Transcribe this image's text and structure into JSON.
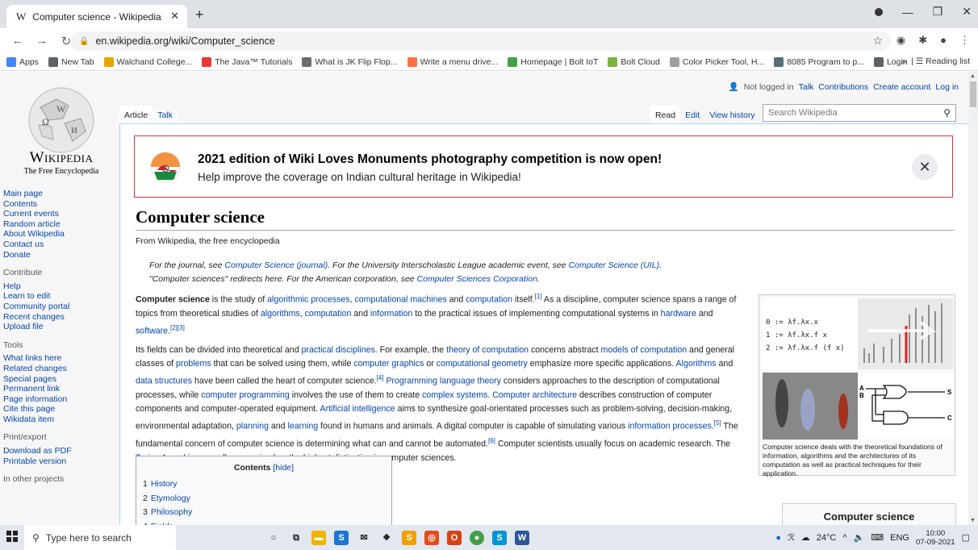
{
  "browser": {
    "tab_title": "Computer science - Wikipedia",
    "tab_favicon": "W",
    "url": "en.wikipedia.org/wiki/Computer_science",
    "bookmarks": [
      {
        "label": "Apps",
        "icon": "apps-grid-icon",
        "color": "#4285f4"
      },
      {
        "label": "New Tab",
        "icon": "globe-icon",
        "color": "#5f6368"
      },
      {
        "label": "Walchand College...",
        "icon": "college-icon",
        "color": "#e8a500"
      },
      {
        "label": "The Java™ Tutorials",
        "icon": "youtube-icon",
        "color": "#e53935"
      },
      {
        "label": "What is JK Flip Flop...",
        "icon": "site-icon",
        "color": "#6d6d6d"
      },
      {
        "label": "Write a menu drive...",
        "icon": "blogger-icon",
        "color": "#ff7043"
      },
      {
        "label": "Homepage | Bolt IoT",
        "icon": "bolt-icon",
        "color": "#43a047"
      },
      {
        "label": "Bolt Cloud",
        "icon": "bolt-cloud-icon",
        "color": "#7cb342"
      },
      {
        "label": "Color Picker Tool, H...",
        "icon": "color-picker-icon",
        "color": "#9e9e9e"
      },
      {
        "label": "8085 Program to p...",
        "icon": "site-icon",
        "color": "#546e7a"
      },
      {
        "label": "Login",
        "icon": "globe-icon",
        "color": "#5f6368"
      }
    ],
    "reading_list": "Reading list",
    "overflow": "»"
  },
  "wiki": {
    "wordmark": "Wikipedia",
    "tagline_logo": "The Free Encyclopedia",
    "nav_main": [
      "Main page",
      "Contents",
      "Current events",
      "Random article",
      "About Wikipedia",
      "Contact us",
      "Donate"
    ],
    "contribute_heading": "Contribute",
    "nav_contribute": [
      "Help",
      "Learn to edit",
      "Community portal",
      "Recent changes",
      "Upload file"
    ],
    "tools_heading": "Tools",
    "nav_tools": [
      "What links here",
      "Related changes",
      "Special pages",
      "Permanent link",
      "Page information",
      "Cite this page",
      "Wikidata item"
    ],
    "print_heading": "Print/export",
    "nav_print": [
      "Download as PDF",
      "Printable version"
    ],
    "other_heading": "In other projects",
    "personal": {
      "not_logged": "Not logged in",
      "talk": "Talk",
      "contributions": "Contributions",
      "create": "Create account",
      "login": "Log in"
    },
    "tab_article": "Article",
    "tab_talk": "Talk",
    "tab_read": "Read",
    "tab_edit": "Edit",
    "tab_history": "View history",
    "search_placeholder": "Search Wikipedia",
    "banner_title": "2021 edition of Wiki Loves Monuments photography competition is now open!",
    "banner_sub": "Help improve the coverage on Indian cultural heritage in Wikipedia!",
    "title": "Computer science",
    "from": "From Wikipedia, the free encyclopedia",
    "hatnote1a": "For the journal, see ",
    "hatnote1b": "Computer Science (journal)",
    "hatnote1c": ". For the University Interscholastic League academic event, see ",
    "hatnote1d": "Computer Science (UIL)",
    "hatnote1e": ".",
    "hatnote2a": "\"Computer sciences\" redirects here. For the American corporation, see ",
    "hatnote2b": "Computer Sciences Corporation",
    "hatnote2c": ".",
    "infobox_caption": "Computer science deals with the theoretical foundations of information, algorithms and the architectures of its computation as well as practical techniques for their application.",
    "infobox_lambda": [
      "0 := λf.λx.x",
      "1 := λf.λx.f x",
      "2 := λf.λx.f (f x)"
    ],
    "infobox_gate_labels": [
      "A",
      "B",
      "S",
      "C"
    ],
    "toc_heading": "Contents",
    "toc_hide": "[hide]",
    "toc": [
      {
        "num": "1",
        "label": "History"
      },
      {
        "num": "2",
        "label": "Etymology"
      },
      {
        "num": "3",
        "label": "Philosophy"
      },
      {
        "num": "4",
        "label": "Fields"
      }
    ],
    "navbox_title": "Computer science"
  },
  "taskbar": {
    "search_placeholder": "Type here to search",
    "weather": "24°C",
    "lang": "ENG",
    "time": "10:00",
    "date": "07-09-2021"
  },
  "colors": {
    "link": "#0645ad",
    "banner_border": "#dd3333",
    "chrome_tabstrip": "#dee1e6"
  }
}
